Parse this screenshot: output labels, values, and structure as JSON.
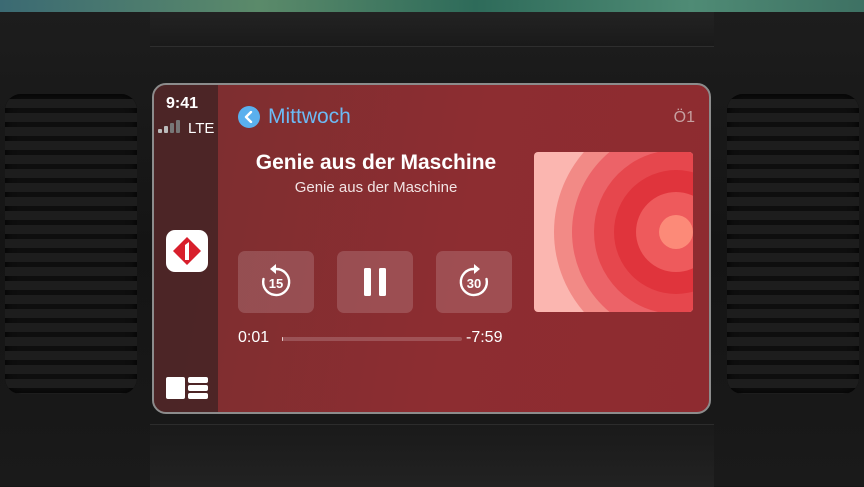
{
  "status": {
    "time": "9:41",
    "network": "LTE"
  },
  "header": {
    "back_label": "Mittwoch",
    "station": "Ö1"
  },
  "episode": {
    "title": "Genie aus der Maschine",
    "subtitle": "Genie aus der Maschine"
  },
  "controls": {
    "skip_back_seconds": "15",
    "skip_forward_seconds": "30"
  },
  "playback": {
    "elapsed": "0:01",
    "remaining": "-7:59",
    "progress_fraction": 0.002
  },
  "colors": {
    "accent": "#5ab0ee",
    "background": "#8d2d31",
    "art_base": "#fbb6b0"
  },
  "icons": {
    "back": "chevron-left-icon",
    "app": "podcast-app-icon",
    "dashboard": "dashboard-icon",
    "skip_back": "skip-back-15-icon",
    "pause": "pause-icon",
    "skip_forward": "skip-forward-30-icon"
  }
}
